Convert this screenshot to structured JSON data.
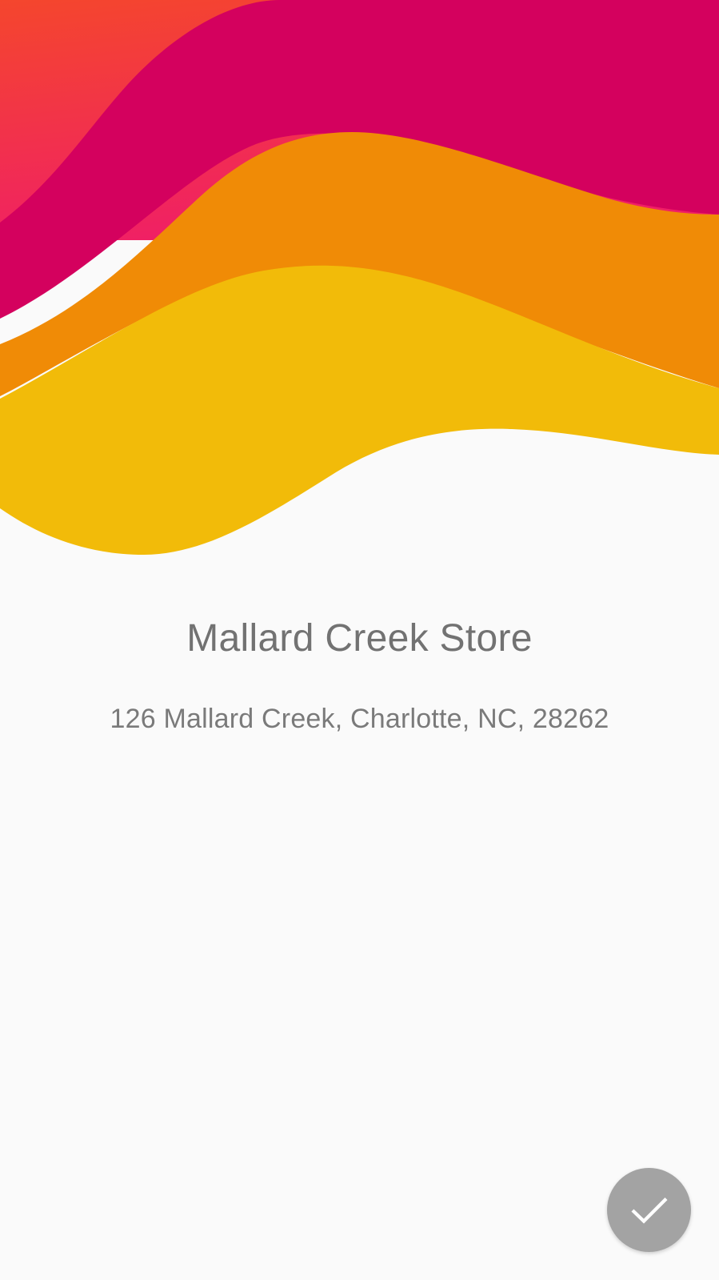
{
  "store": {
    "name": "Mallard Creek Store",
    "address": "126 Mallard Creek, Charlotte, NC, 28262"
  },
  "header_graphic": {
    "colors": {
      "orange_red": "#f4462d",
      "pink": "#f01f66",
      "magenta": "#d4015e",
      "orange": "#f08b06",
      "yellow": "#f2bb09"
    }
  },
  "confirm_button": {
    "icon": "check-icon",
    "background": "#a3a3a3"
  }
}
